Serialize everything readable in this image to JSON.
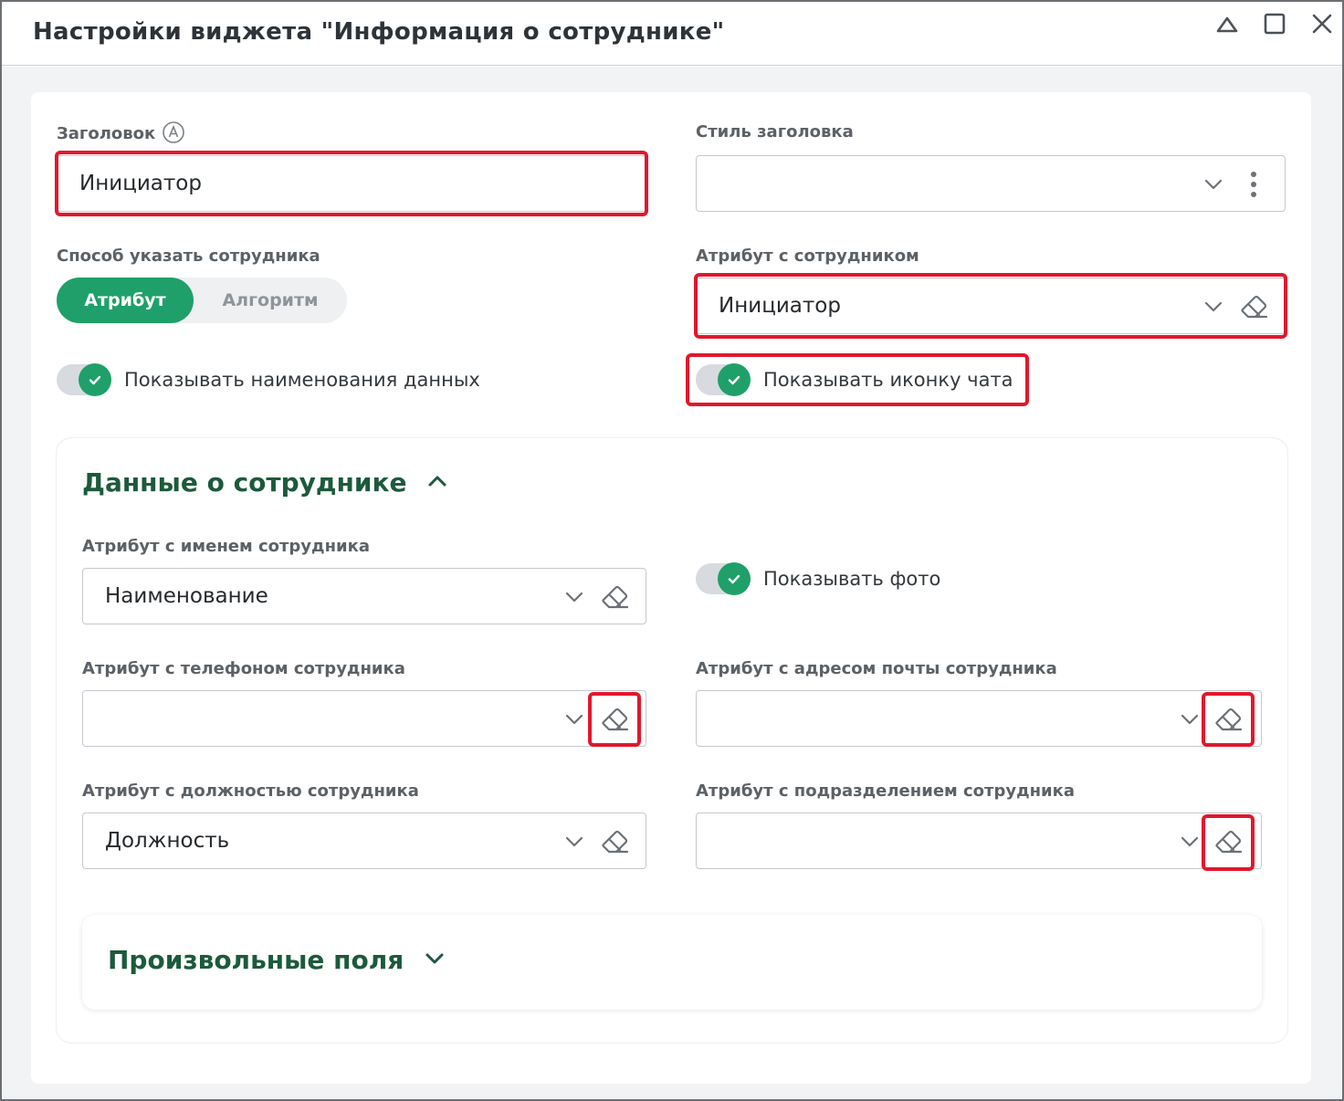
{
  "window": {
    "title": "Настройки виджета \"Информация о сотруднике\"",
    "buttons": [
      "collapse-icon",
      "maximize-icon",
      "close-icon"
    ]
  },
  "heading": {
    "label": "Заголовок",
    "value": "Инициатор"
  },
  "heading_style": {
    "label": "Стиль заголовка",
    "value": ""
  },
  "employee_mode": {
    "label": "Способ указать сотрудника",
    "options": [
      "Атрибут",
      "Алгоритм"
    ],
    "selected": "Атрибут"
  },
  "employee_attr": {
    "label": "Атрибут с сотрудником",
    "value": "Инициатор"
  },
  "toggles": {
    "show_data_names": {
      "label": "Показывать наименования данных",
      "on": true
    },
    "show_chat_icon": {
      "label": "Показывать иконку чата",
      "on": true
    },
    "show_photo": {
      "label": "Показывать фото",
      "on": true
    }
  },
  "employee_data": {
    "title": "Данные о сотруднике",
    "name_attr": {
      "label": "Атрибут с именем сотрудника",
      "value": "Наименование"
    },
    "phone_attr": {
      "label": "Атрибут с телефоном сотрудника",
      "value": ""
    },
    "email_attr": {
      "label": "Атрибут с адресом почты сотрудника",
      "value": ""
    },
    "position_attr": {
      "label": "Атрибут с должностью сотрудника",
      "value": "Должность"
    },
    "department_attr": {
      "label": "Атрибут с подразделением сотрудника",
      "value": ""
    }
  },
  "custom_fields": {
    "title": "Произвольные поля"
  },
  "colors": {
    "accent": "#1fa06a",
    "section_title": "#1c5a3c",
    "highlight": "#e0182d"
  }
}
